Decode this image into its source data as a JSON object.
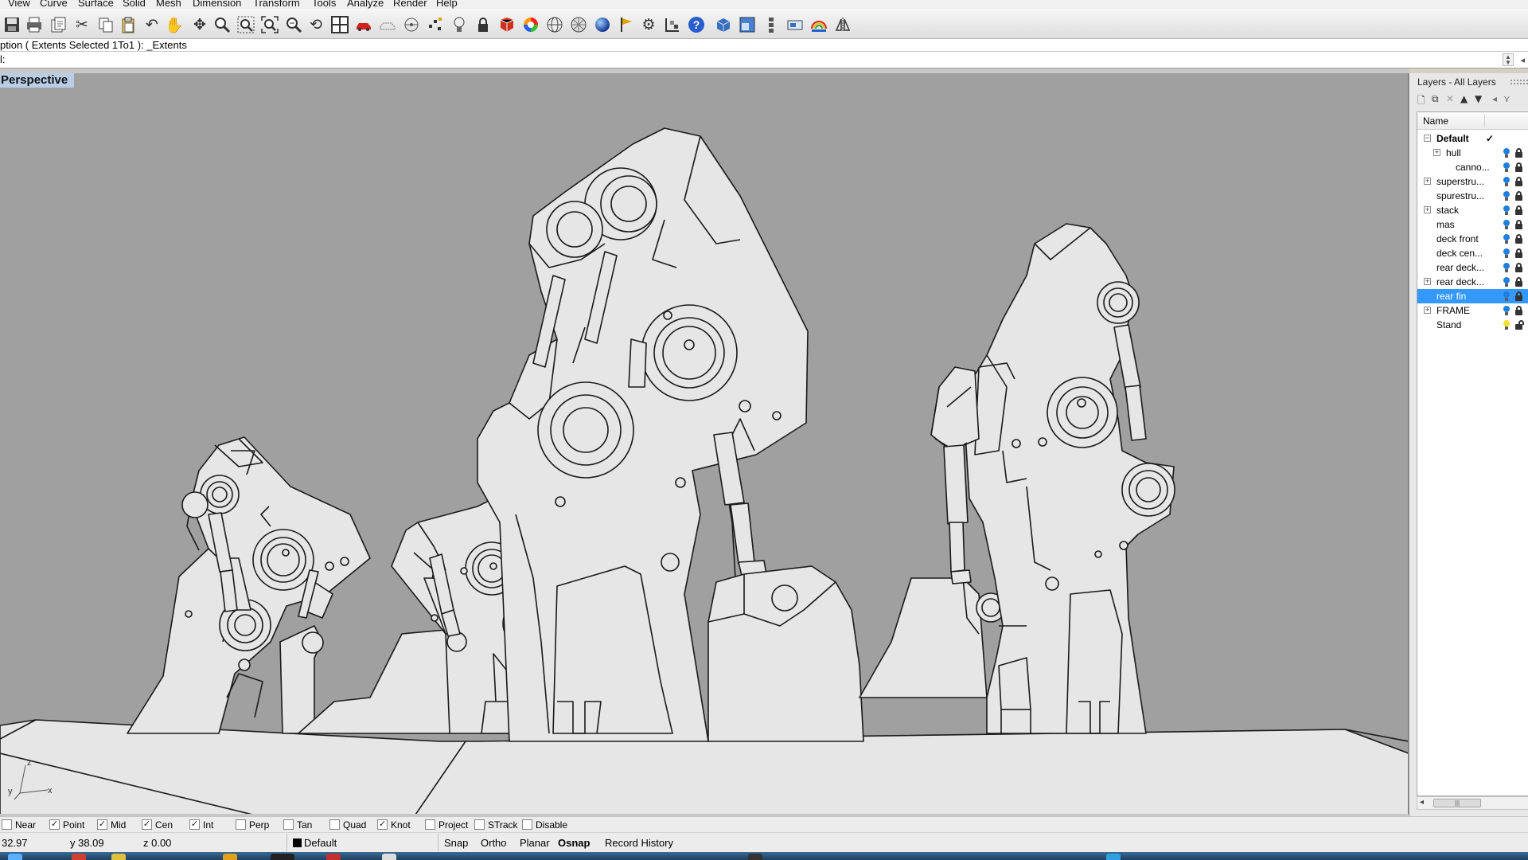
{
  "menubar": {
    "items": [
      "View",
      "Curve",
      "Surface",
      "Solid",
      "Mesh",
      "Dimension",
      "Transform",
      "Tools",
      "Analyze",
      "Render",
      "Help"
    ]
  },
  "toolbar": {
    "icons": [
      "save-icon",
      "print-icon",
      "export-icon",
      "cut-icon",
      "copy-icon",
      "paste-icon",
      "undo-icon",
      "pan-icon",
      "move-view-icon",
      "zoom-icon",
      "zoom-window-icon",
      "zoom-extents-icon",
      "zoom-selected-icon",
      "rotate-view-icon",
      "four-viewports-icon",
      "car-icon",
      "ghosted-icon",
      "osnap-icon",
      "points-icon",
      "light-icon",
      "lock-icon",
      "render-mesh-icon",
      "color-wheel-icon",
      "sphere-icon",
      "grid-icon",
      "render-sphere-icon",
      "flag-icon",
      "settings-gear-icon",
      "options-icon",
      "help-icon",
      "box-icon",
      "viewport-layout-icon",
      "properties-icon",
      "named-view-icon",
      "rainbow-icon",
      "mirror-icon"
    ]
  },
  "command": {
    "history": "ption ( Extents  Selected  1To1 ): _Extents",
    "prompt": "l:"
  },
  "viewport": {
    "title": "Perspective",
    "axes": {
      "z": "z",
      "y": "y",
      "x": "x"
    }
  },
  "layers": {
    "title": "Layers - All Layers",
    "column_name": "Name",
    "rows": [
      {
        "name": "Default",
        "level": 0,
        "expander": "−",
        "current": true,
        "check": "✓",
        "bold": true
      },
      {
        "name": "hull",
        "level": 1,
        "expander": "+",
        "bulb": "blue",
        "lock": "locked"
      },
      {
        "name": "canno...",
        "level": 2,
        "expander": "",
        "bulb": "blue",
        "lock": "locked"
      },
      {
        "name": "superstru...",
        "level": 0,
        "expander": "+",
        "bulb": "blue",
        "lock": "locked"
      },
      {
        "name": "spurestru...",
        "level": 0,
        "expander": "",
        "bulb": "blue",
        "lock": "locked"
      },
      {
        "name": "stack",
        "level": 0,
        "expander": "+",
        "bulb": "blue",
        "lock": "locked"
      },
      {
        "name": "mas",
        "level": 0,
        "expander": "",
        "bulb": "blue",
        "lock": "locked"
      },
      {
        "name": "deck front",
        "level": 0,
        "expander": "",
        "bulb": "blue",
        "lock": "locked"
      },
      {
        "name": "deck cen...",
        "level": 0,
        "expander": "",
        "bulb": "blue",
        "lock": "locked"
      },
      {
        "name": "rear deck...",
        "level": 0,
        "expander": "",
        "bulb": "blue",
        "lock": "locked"
      },
      {
        "name": "rear deck...",
        "level": 0,
        "expander": "+",
        "bulb": "blue",
        "lock": "locked"
      },
      {
        "name": "rear fin",
        "level": 0,
        "expander": "",
        "bulb": "blue",
        "lock": "locked",
        "selected": true
      },
      {
        "name": "FRAME",
        "level": 0,
        "expander": "+",
        "bulb": "blue",
        "lock": "locked"
      },
      {
        "name": "Stand",
        "level": 0,
        "expander": "",
        "bulb": "yellow",
        "lock": "unlocked"
      }
    ],
    "scroll_thumb": "|||"
  },
  "osnap": [
    {
      "label": "Near",
      "checked": false
    },
    {
      "label": "Point",
      "checked": true
    },
    {
      "label": "Mid",
      "checked": true
    },
    {
      "label": "Cen",
      "checked": true
    },
    {
      "label": "Int",
      "checked": true
    },
    {
      "label": "Perp",
      "checked": false
    },
    {
      "label": "Tan",
      "checked": false
    },
    {
      "label": "Quad",
      "checked": false
    },
    {
      "label": "Knot",
      "checked": true
    },
    {
      "label": "Project",
      "checked": false
    },
    {
      "label": "STrack",
      "checked": false
    },
    {
      "label": "Disable",
      "checked": false
    }
  ],
  "status": {
    "x": "32.97",
    "y": "y 38.09",
    "z": "z 0.00",
    "layer": "Default",
    "snap": "Snap",
    "ortho": "Ortho",
    "planar": "Planar",
    "osnap": "Osnap",
    "record_history": "Record History"
  },
  "colors": {
    "viewport_bg": "#a0a0a0",
    "viewport_tab": "#b9cee6",
    "selection": "#3399ff",
    "model_fill": "#e6e6e6",
    "model_stroke": "#1a1a1a"
  }
}
